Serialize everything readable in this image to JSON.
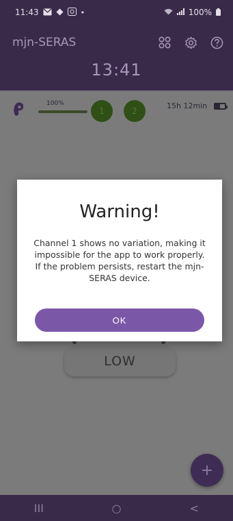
{
  "status_bar": {
    "time": "11:43",
    "battery": "100%"
  },
  "app": {
    "title": "mjn-SERAS",
    "clock": "13:41"
  },
  "info_bar": {
    "level_label": "100%",
    "level_fraction": 1.0,
    "channels": [
      "1",
      "2"
    ],
    "remaining_time": "15h 12min"
  },
  "mode": {
    "label": "LOW"
  },
  "fab": {
    "label": "+"
  },
  "dialog": {
    "title": "Warning!",
    "message": "Channel 1 shows no variation, making it impossible for the app to work properly. If the problem persists, restart the mjn-SERAS device.",
    "ok_label": "OK"
  },
  "nav": {
    "recent": "III",
    "home": "○",
    "back": "<"
  },
  "colors": {
    "primary": "#7b57a8",
    "header": "#3a2a4a",
    "channel": "#2f4f17"
  }
}
